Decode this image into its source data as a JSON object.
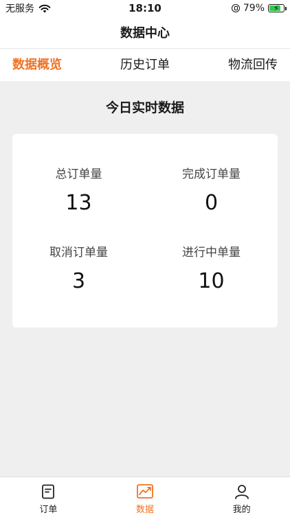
{
  "status_bar": {
    "carrier": "无服务",
    "time": "18:10",
    "battery_percent": "79%",
    "battery_level": 0.79,
    "icons": [
      "wifi-icon",
      "orientation-lock-icon",
      "battery-icon"
    ]
  },
  "nav": {
    "title": "数据中心"
  },
  "tabs": [
    {
      "label": "数据概览",
      "active": true
    },
    {
      "label": "历史订单",
      "active": false
    },
    {
      "label": "物流回传",
      "active": false
    }
  ],
  "overview": {
    "title": "今日实时数据",
    "stats": [
      {
        "label": "总订单量",
        "value": "13"
      },
      {
        "label": "完成订单量",
        "value": "0"
      },
      {
        "label": "取消订单量",
        "value": "3"
      },
      {
        "label": "进行中单量",
        "value": "10"
      }
    ]
  },
  "bottom_nav": [
    {
      "label": "订单",
      "icon": "order-list-icon",
      "active": false
    },
    {
      "label": "数据",
      "icon": "chart-icon",
      "active": true
    },
    {
      "label": "我的",
      "icon": "user-icon",
      "active": false
    }
  ],
  "colors": {
    "accent": "#ef7324",
    "background": "#efefef",
    "battery_green": "#31c94b"
  }
}
